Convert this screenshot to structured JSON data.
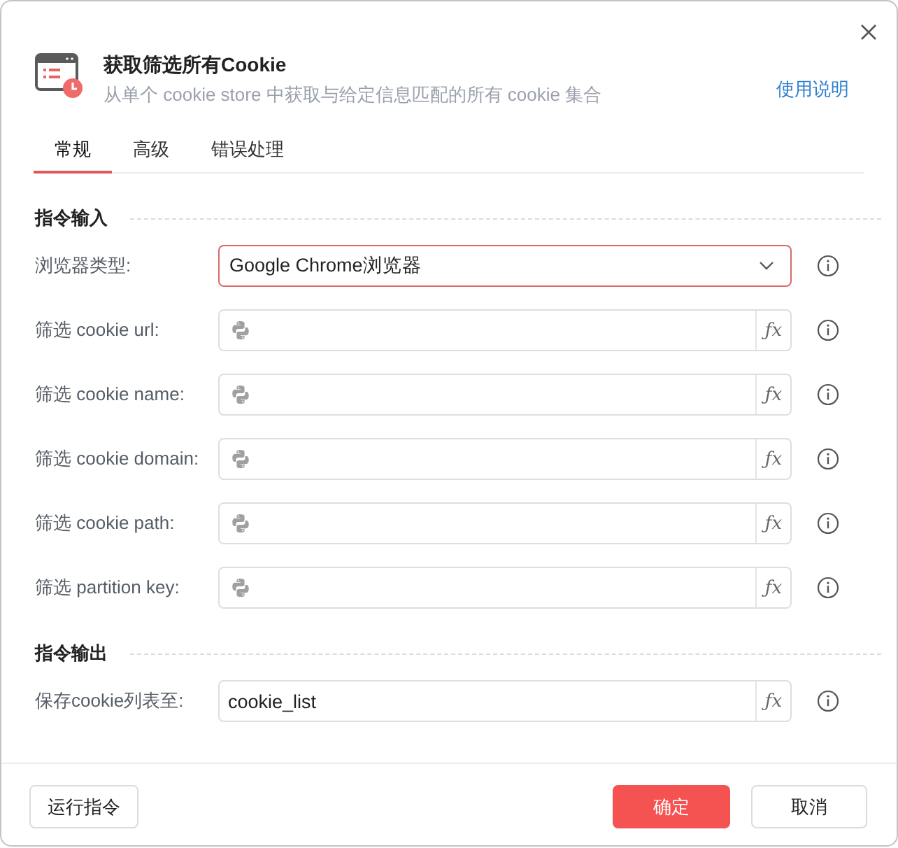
{
  "dialog": {
    "title": "获取筛选所有Cookie",
    "subtitle": "从单个 cookie store 中获取与给定信息匹配的所有 cookie 集合",
    "help_link": "使用说明"
  },
  "tabs": [
    {
      "label": "常规",
      "selected": true
    },
    {
      "label": "高级",
      "selected": false
    },
    {
      "label": "错误处理",
      "selected": false
    }
  ],
  "sections": [
    {
      "title": "指令输入",
      "fields": [
        {
          "label": "浏览器类型:",
          "kind": "select",
          "value": "Google Chrome浏览器",
          "focused": true
        },
        {
          "label": "筛选 cookie url:",
          "kind": "expression",
          "fx_button": "ƒx",
          "focused": false
        },
        {
          "label": "筛选 cookie name:",
          "kind": "expression",
          "fx_button": "ƒx",
          "focused": false
        },
        {
          "label": "筛选 cookie domain:",
          "kind": "expression",
          "fx_button": "ƒx",
          "focused": false
        },
        {
          "label": "筛选 cookie path:",
          "kind": "expression",
          "fx_button": "ƒx",
          "focused": false
        },
        {
          "label": "筛选 partition key:",
          "kind": "expression",
          "fx_button": "ƒx",
          "focused": false
        }
      ]
    },
    {
      "title": "指令输出",
      "fields": [
        {
          "label": "保存cookie列表至:",
          "kind": "expression",
          "value": "cookie_list",
          "fx_button": "ƒx",
          "focused": false
        }
      ]
    }
  ],
  "footer": {
    "run_button": "运行指令",
    "confirm_button": "确定",
    "cancel_button": "取消"
  }
}
